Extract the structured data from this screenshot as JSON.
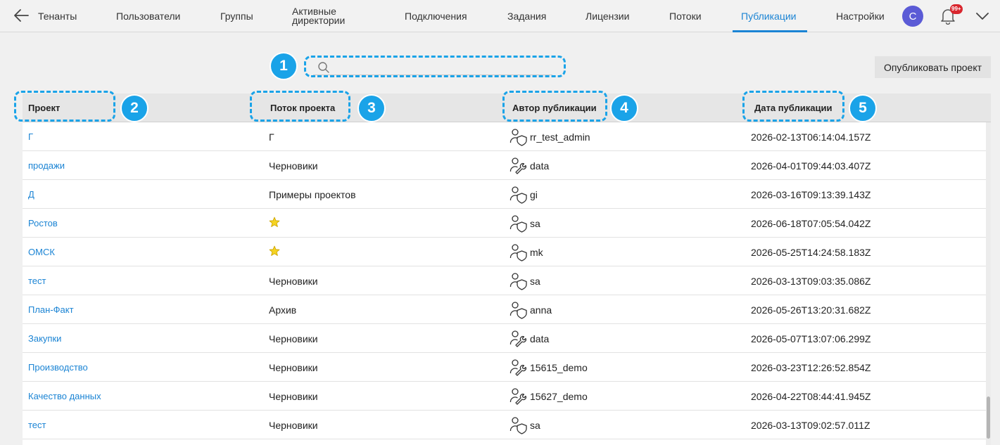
{
  "nav": {
    "back_icon": "arrow-left-icon",
    "tenants": "Тенанты",
    "users": "Пользователи",
    "groups": "Группы",
    "active_directories": "Активные директории",
    "connections": "Подключения",
    "jobs": "Задания",
    "licenses": "Лицензии",
    "flows": "Потоки",
    "publications": "Публикации",
    "settings": "Настройки",
    "avatar_letter": "C",
    "notification_count": "99+",
    "active_color": "#1b84d4"
  },
  "search": {
    "placeholder": "",
    "value": ""
  },
  "publish_button": "Опубликовать проект",
  "markers": [
    "1",
    "2",
    "3",
    "4",
    "5"
  ],
  "table": {
    "columns": [
      "Проект",
      "Поток проекта",
      "Автор публикации",
      "Дата публикации"
    ],
    "rows": [
      {
        "project": "Г",
        "flow": "Г",
        "author_icon": "user-shield-icon",
        "author": "rr_test_admin",
        "date": "2026-02-13T06:14:04.157Z"
      },
      {
        "project": "продажи",
        "flow": "Черновики",
        "author_icon": "user-wrench-icon",
        "author": "data",
        "date": "2026-04-01T09:44:03.407Z"
      },
      {
        "project": "Д",
        "flow": "Примеры проектов",
        "author_icon": "user-shield-icon",
        "author": "gi",
        "date": "2026-03-16T09:13:39.143Z"
      },
      {
        "project": "Ростов",
        "flow": "",
        "flow_icon": "star-icon",
        "author_icon": "user-shield-icon",
        "author": "sa",
        "date": "2026-06-18T07:05:54.042Z"
      },
      {
        "project": "ОМСК",
        "flow": "",
        "flow_icon": "star-icon",
        "author_icon": "user-shield-icon",
        "author": "mk",
        "date": "2026-05-25T14:24:58.183Z"
      },
      {
        "project": "тест",
        "flow": "Черновики",
        "author_icon": "user-shield-icon",
        "author": "sa",
        "date": "2026-03-13T09:03:35.086Z"
      },
      {
        "project": "План-Факт",
        "flow": "Архив",
        "author_icon": "user-shield-icon",
        "author": "anna",
        "date": "2026-05-26T13:20:31.682Z"
      },
      {
        "project": "Закупки",
        "flow": "Черновики",
        "author_icon": "user-wrench-icon",
        "author": "data",
        "date": "2026-05-07T13:07:06.299Z"
      },
      {
        "project": "Производство",
        "flow": "Черновики",
        "author_icon": "user-wrench-icon",
        "author": "15615_demo",
        "date": "2026-03-23T12:26:52.854Z"
      },
      {
        "project": "Качество данных",
        "flow": "Черновики",
        "author_icon": "user-wrench-icon",
        "author": "15627_demo",
        "date": "2026-04-22T08:44:41.945Z"
      },
      {
        "project": "тест",
        "flow": "Черновики",
        "author_icon": "user-shield-icon",
        "author": "sa",
        "date": "2026-03-13T09:02:57.011Z"
      }
    ]
  },
  "colors": {
    "link": "#1b84d4",
    "highlight": "#1aa3e8",
    "badge": "#d9262e",
    "avatar": "#5b5bd6"
  }
}
